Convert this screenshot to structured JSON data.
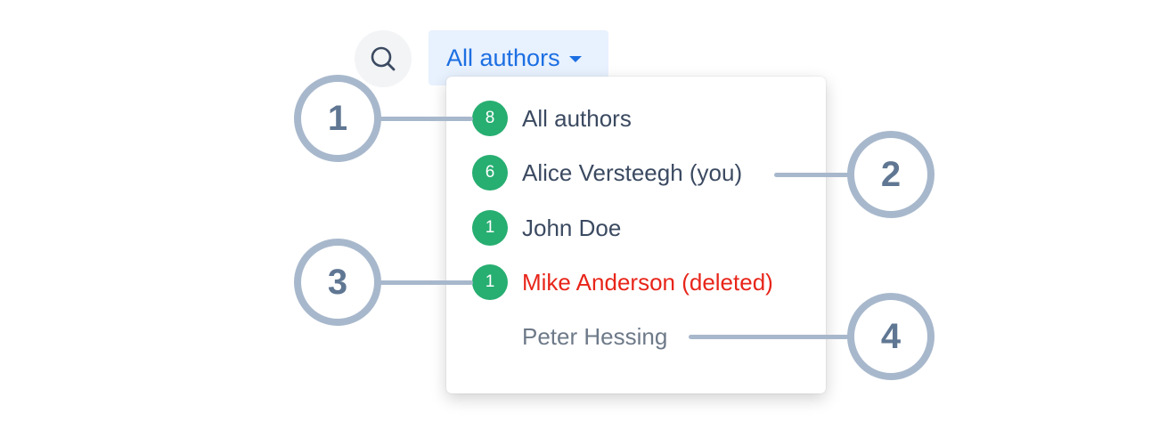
{
  "search": {
    "icon": "search-icon"
  },
  "filter": {
    "label": "All authors",
    "icon": "caret-down-icon",
    "color": "#1c6fe2",
    "background": "#e8f1fe"
  },
  "menu": {
    "items": [
      {
        "label": "All authors",
        "count": "8",
        "state": "normal"
      },
      {
        "label": "Alice Versteegh (you)",
        "count": "6",
        "state": "normal"
      },
      {
        "label": "John Doe",
        "count": "1",
        "state": "normal"
      },
      {
        "label": "Mike Anderson (deleted)",
        "count": "1",
        "state": "deleted"
      },
      {
        "label": "Peter Hessing",
        "count": "",
        "state": "inactive"
      }
    ],
    "badge_color": "#27ae71",
    "deleted_color": "#e8251a"
  },
  "callouts": [
    {
      "number": "1"
    },
    {
      "number": "2"
    },
    {
      "number": "3"
    },
    {
      "number": "4"
    }
  ],
  "callout_color": "#a8b8cc"
}
